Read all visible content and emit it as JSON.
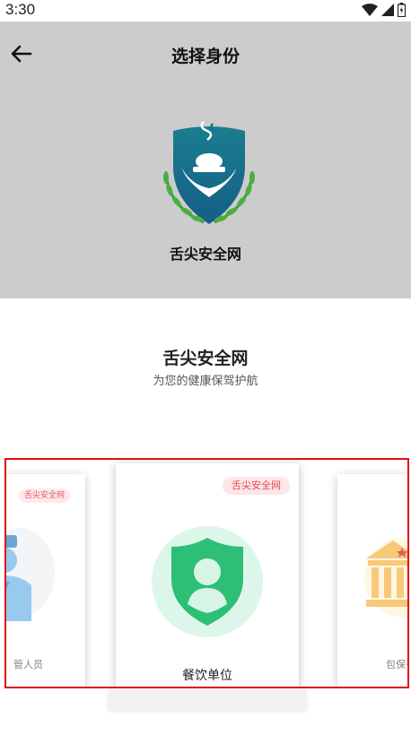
{
  "status": {
    "time": "3:30"
  },
  "header": {
    "title": "选择身份",
    "app_name": "舌尖安全网"
  },
  "hero": {
    "title": "舌尖安全网",
    "subtitle": "为您的健康保驾护航"
  },
  "cards": {
    "left": {
      "tag": "舌尖安全网",
      "label": "管人员"
    },
    "main": {
      "tag": "舌尖安全网",
      "label": "餐饮单位"
    },
    "right": {
      "label": "包保干"
    }
  },
  "icons": {
    "back": "arrow-left-icon",
    "wifi": "wifi-icon",
    "signal": "cell-signal-icon",
    "battery": "battery-icon",
    "logo": "food-safety-logo",
    "main_card": "shield-user-icon",
    "left_card": "officer-icon",
    "right_card": "government-building-icon"
  },
  "colors": {
    "header_bg": "#cccccc",
    "tag_bg": "#fde6e8",
    "tag_text": "#e04a5a",
    "shield_green": "#2cbf75",
    "circle_green": "#dcf7ea",
    "highlight_border": "#e01010"
  }
}
